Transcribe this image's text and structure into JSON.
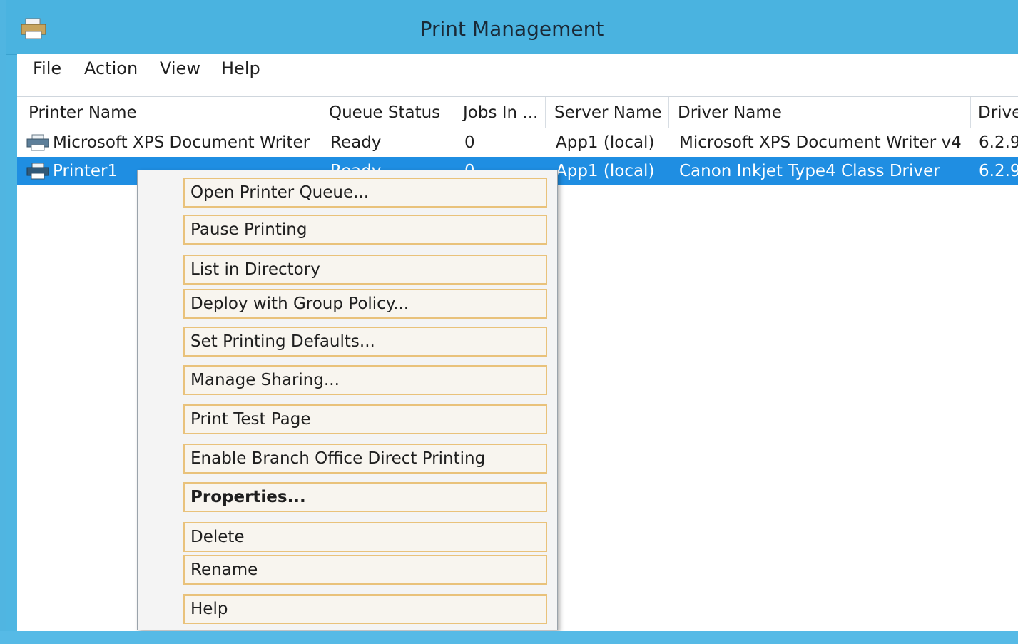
{
  "window": {
    "title": "Print Management"
  },
  "menu": {
    "file": "File",
    "action": "Action",
    "view": "View",
    "help": "Help"
  },
  "columns": {
    "printer_name": "Printer Name",
    "queue_status": "Queue Status",
    "jobs_in": "Jobs In ...",
    "server_name": "Server Name",
    "driver_name": "Driver Name",
    "driver_version": "Drive"
  },
  "rows": [
    {
      "printer_name": "Microsoft XPS Document Writer",
      "queue_status": "Ready",
      "jobs_in": "0",
      "server_name": "App1 (local)",
      "driver_name": "Microsoft XPS Document Writer v4",
      "driver_version": "6.2.9"
    },
    {
      "printer_name": "Printer1",
      "queue_status": "Ready",
      "jobs_in": "0",
      "server_name": "App1 (local)",
      "driver_name": "Canon Inkjet Type4 Class Driver",
      "driver_version": "6.2.9"
    }
  ],
  "context_menu": {
    "open_queue": "Open Printer Queue...",
    "pause": "Pause Printing",
    "list_directory": "List in Directory",
    "deploy": "Deploy with Group Policy...",
    "defaults": "Set Printing Defaults...",
    "sharing": "Manage Sharing...",
    "test_page": "Print Test Page",
    "branch": "Enable Branch Office Direct Printing",
    "properties": "Properties...",
    "delete": "Delete",
    "rename": "Rename",
    "help": "Help"
  },
  "colors": {
    "titlebar": "#4ab3e0",
    "selection": "#1f8ee2",
    "menu_outline": "#e9c27b"
  }
}
